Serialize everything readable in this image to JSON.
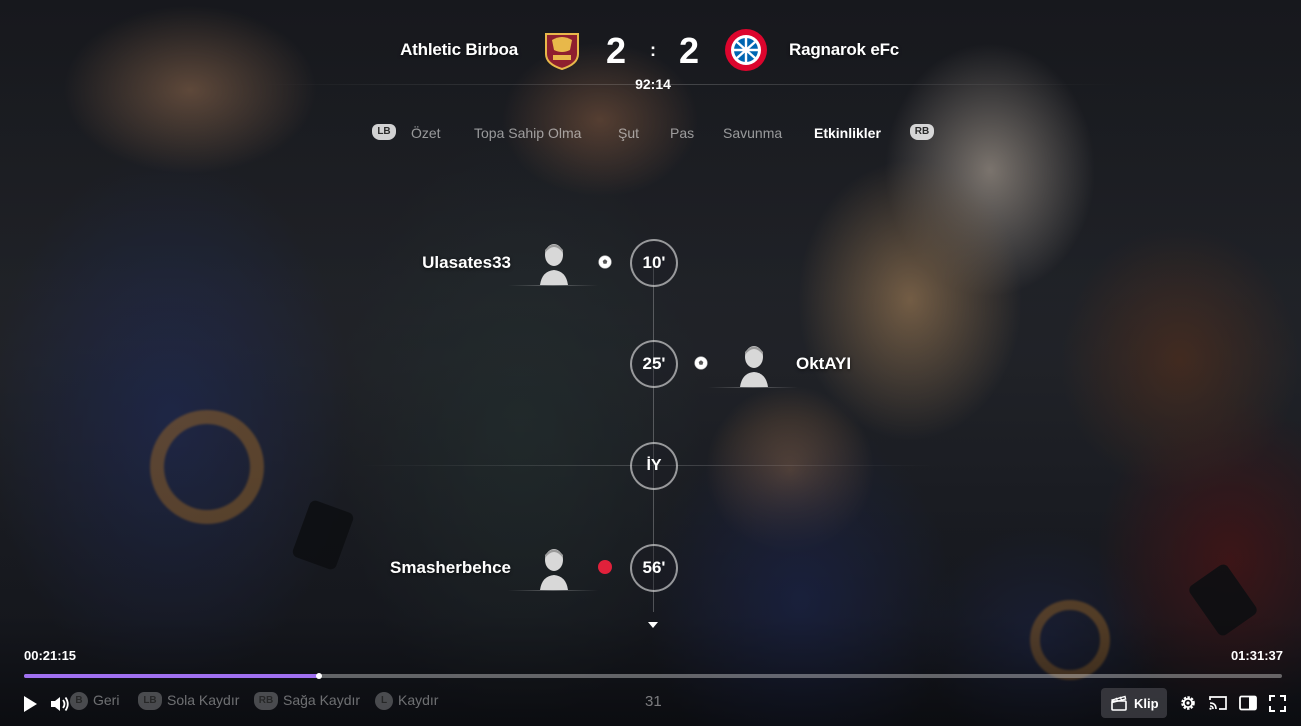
{
  "match": {
    "home_team": "Athletic Birboa",
    "away_team": "Ragnarok eFc",
    "home_score": "2",
    "away_score": "2",
    "separator": ":",
    "clock": "92:14",
    "home_crest": "roma-crest-icon",
    "away_crest": "bayern-crest-icon"
  },
  "tabs": {
    "left_bumper": "LB",
    "right_bumper": "RB",
    "items": [
      {
        "label": "Özet"
      },
      {
        "label": "Topa Sahip Olma"
      },
      {
        "label": "Şut"
      },
      {
        "label": "Pas"
      },
      {
        "label": "Savunma"
      },
      {
        "label": "Etkinlikler",
        "active": true
      }
    ]
  },
  "events": [
    {
      "minute": "10'",
      "side": "home",
      "player": "Ulasates33",
      "type": "goal",
      "icon": "football-icon"
    },
    {
      "minute": "25'",
      "side": "away",
      "player": "OktAYI",
      "type": "goal",
      "icon": "football-icon"
    },
    {
      "minute": "İY",
      "type": "half-time"
    },
    {
      "minute": "56'",
      "side": "home",
      "player": "Smasherbehce",
      "type": "red-card",
      "icon": "red-card-icon"
    }
  ],
  "player_controls": {
    "current_time": "00:21:15",
    "duration": "01:31:37",
    "progress_fraction": 0.2346,
    "hints": [
      {
        "button": "B",
        "label": "Geri"
      },
      {
        "button": "LB",
        "label": "Sola Kaydır"
      },
      {
        "button": "RB",
        "label": "Sağa Kaydır"
      },
      {
        "button": "L",
        "label": "Kaydır"
      }
    ],
    "center_number": "31",
    "clip_label": "Klip",
    "accent_color": "#a070f0",
    "icons": [
      "play-icon",
      "volume-icon",
      "clip-icon",
      "settings-gear-icon",
      "cast-icon",
      "theater-mode-icon",
      "fullscreen-icon"
    ]
  }
}
